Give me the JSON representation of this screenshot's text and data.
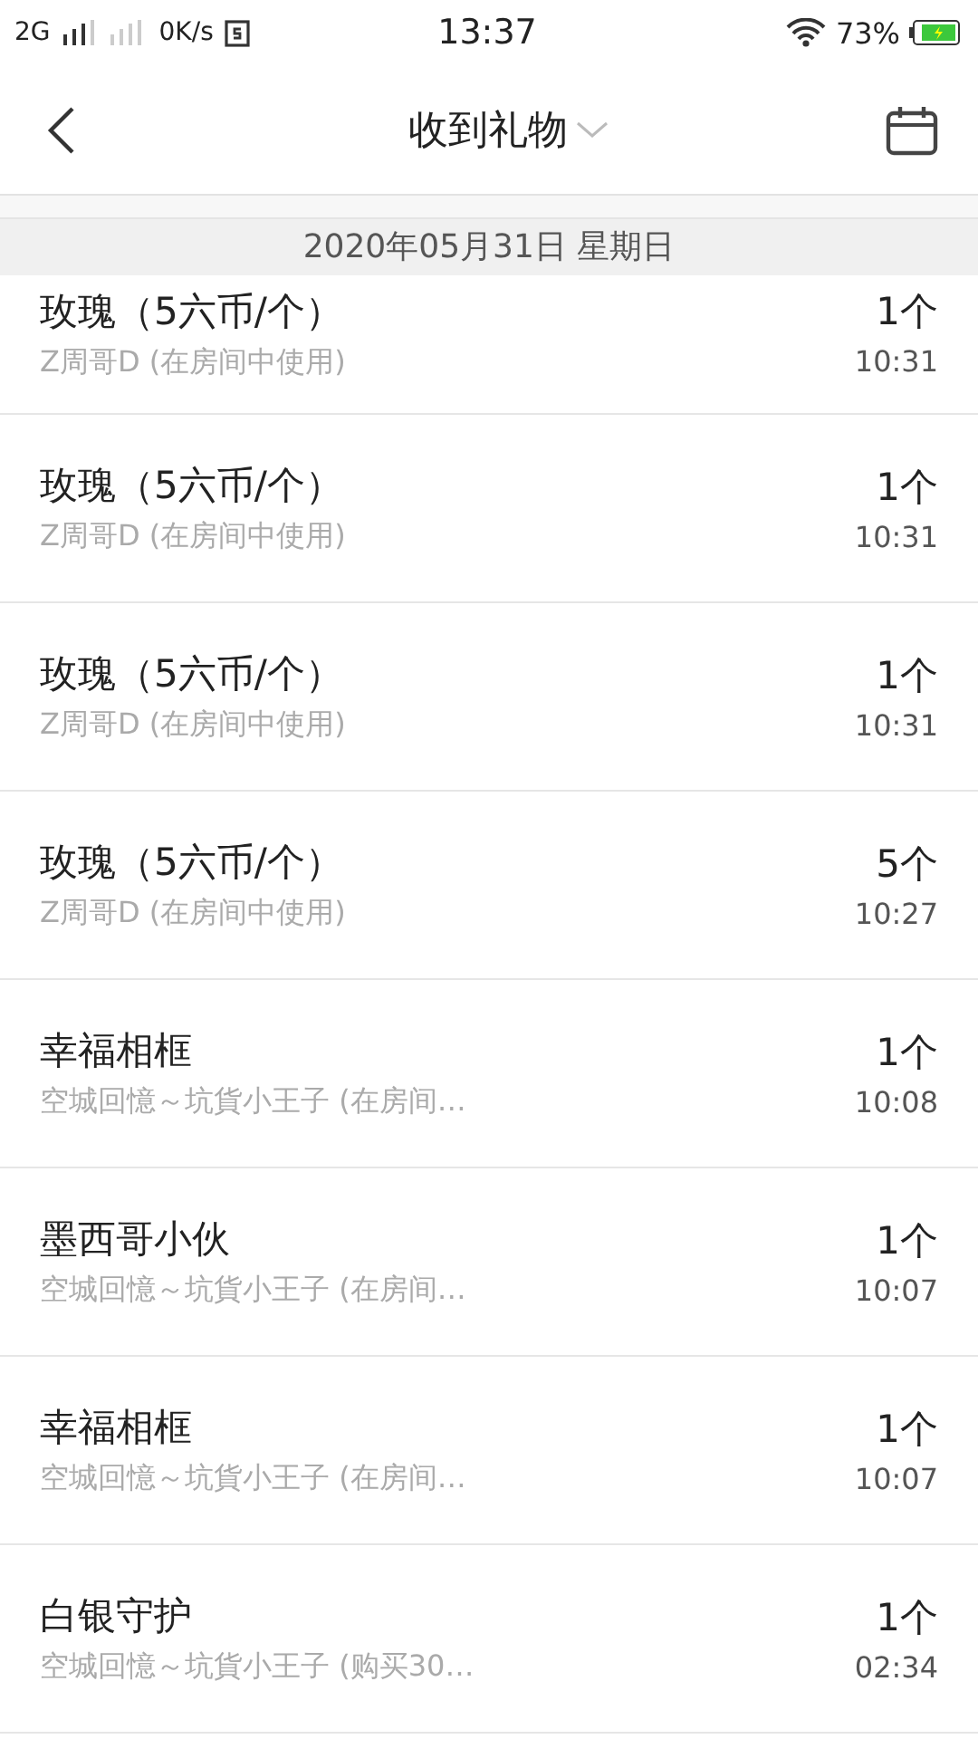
{
  "status_bar": {
    "network": "2G",
    "speed": "0K/s",
    "time": "13:37",
    "battery": "73%"
  },
  "nav": {
    "title": "收到礼物"
  },
  "date_header": "2020年05月31日 星期日",
  "rows": [
    {
      "gift": "玫瑰（5六币/个）",
      "detail": "Z周哥D (在房间中使用)",
      "count": "1个",
      "time": "10:31"
    },
    {
      "gift": "玫瑰（5六币/个）",
      "detail": "Z周哥D (在房间中使用)",
      "count": "1个",
      "time": "10:31"
    },
    {
      "gift": "玫瑰（5六币/个）",
      "detail": "Z周哥D (在房间中使用)",
      "count": "1个",
      "time": "10:31"
    },
    {
      "gift": "玫瑰（5六币/个）",
      "detail": "Z周哥D (在房间中使用)",
      "count": "5个",
      "time": "10:27"
    },
    {
      "gift": "幸福相框",
      "detail": "空城回憶～坑貨小王子 (在房间…",
      "count": "1个",
      "time": "10:08"
    },
    {
      "gift": "墨西哥小伙",
      "detail": "空城回憶～坑貨小王子 (在房间…",
      "count": "1个",
      "time": "10:07"
    },
    {
      "gift": "幸福相框",
      "detail": "空城回憶～坑貨小王子 (在房间…",
      "count": "1个",
      "time": "10:07"
    },
    {
      "gift": "白银守护",
      "detail": "空城回憶～坑貨小王子 (购买30…",
      "count": "1个",
      "time": "02:34"
    }
  ]
}
